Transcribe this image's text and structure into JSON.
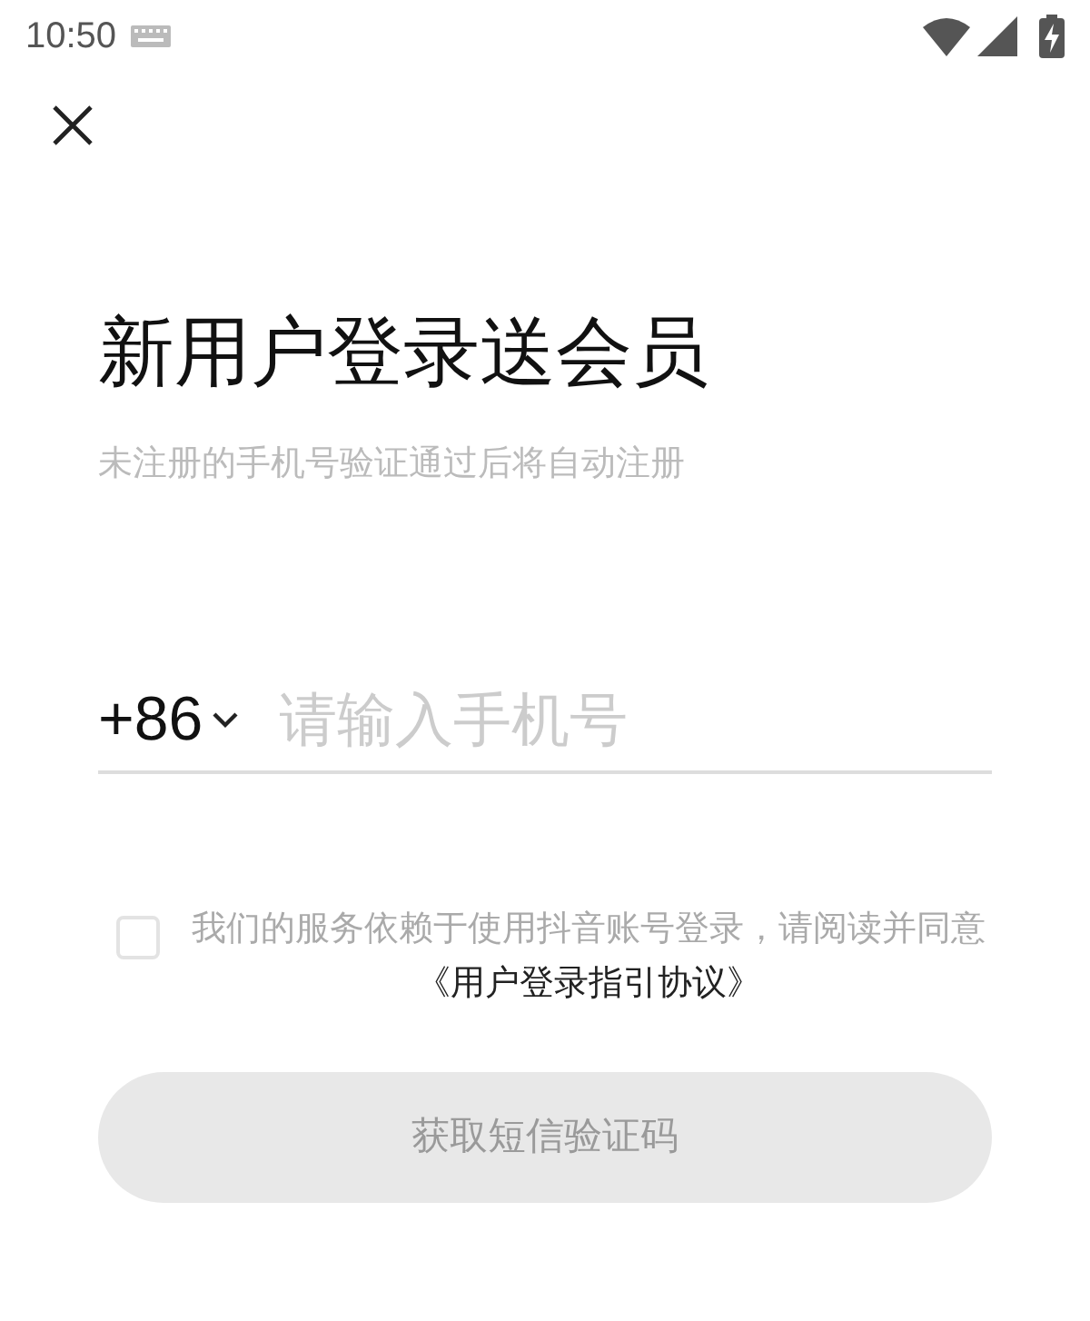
{
  "status_bar": {
    "time": "10:50"
  },
  "title": "新用户登录送会员",
  "subtitle": "未注册的手机号验证通过后将自动注册",
  "phone": {
    "country_code": "+86",
    "placeholder": "请输入手机号"
  },
  "agreement": {
    "checked": false,
    "text": "我们的服务依赖于使用抖音账号登录，请阅读并同意",
    "link": "《用户登录指引协议》"
  },
  "submit": {
    "label": "获取短信验证码",
    "disabled": true
  }
}
